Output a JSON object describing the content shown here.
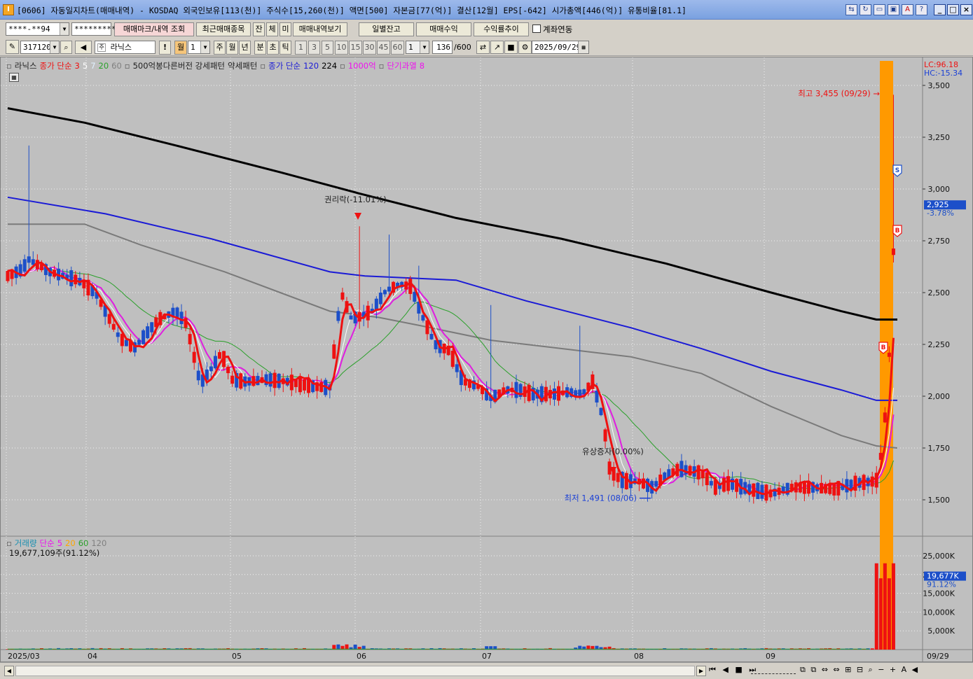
{
  "window": {
    "app_badge": "I",
    "title": "[0606] 자동일지차트(매매내역) - KOSDAQ 외국인보유[113(천)] 주식수[15,260(천)] 액면[500] 자본금[77(억)] 결산[12월] EPS[-642] 시가총액[446(억)] 유통비율[81.1]"
  },
  "toolbar1": {
    "account": "****-**94",
    "password": "*********",
    "trade_mark_btn": "매매마크/내역 조회",
    "recent_btn": "최근매매종목",
    "jan_btn": "잔",
    "che_btn": "체",
    "mi_btn": "미",
    "history_btn": "매매내역보기",
    "daily_balance_btn": "일별잔고",
    "trade_profit_btn": "매매수익",
    "return_btn": "수익률추이",
    "account_link_label": "계좌연동"
  },
  "toolbar2": {
    "code": "317120",
    "name": "라닉스",
    "excl": "!",
    "period_sel": "월",
    "period_num": "1",
    "periods": [
      "주",
      "월",
      "년",
      "분",
      "초",
      "틱"
    ],
    "numbers": [
      "1",
      "3",
      "5",
      "10",
      "15",
      "30",
      "45",
      "60"
    ],
    "unit_val": "1",
    "count": "136",
    "count_max": "/600",
    "date": "2025/09/29"
  },
  "price_legend": {
    "name": "라닉스",
    "ma_label": "종가 단순",
    "ma_periods": [
      "3",
      "5",
      "7",
      "20",
      "60"
    ],
    "pattern1": "500억봉다른버전 강세패턴",
    "pattern2": "약세패턴",
    "ma2_label": "종가 단순",
    "ma2_periods": [
      "120",
      "224"
    ],
    "amount_label": "1000억",
    "overheat_label": "단기과열",
    "overheat_val": "8"
  },
  "volume_legend": {
    "name": "거래량",
    "ma_label": "단순",
    "ma_periods": [
      "5",
      "20",
      "60",
      "120"
    ],
    "current": "19,677,109주(91.12%)"
  },
  "price_axis": {
    "lc": "LC:96.18",
    "hc": "HC:-15.34",
    "ticks": [
      "3,500",
      "3,250",
      "3,000",
      "2,750",
      "2,500",
      "2,250",
      "2,000",
      "1,750",
      "1,500"
    ],
    "current": "2,925",
    "change": "-3.78%"
  },
  "volume_axis": {
    "ticks": [
      "25,000K",
      "20,000K",
      "15,000K",
      "10,000K",
      "5,000K"
    ],
    "current": "19,677K",
    "ratio": "91.12%"
  },
  "date_axis": {
    "labels": [
      "2025/03",
      "04",
      "05",
      "06",
      "07",
      "08",
      "09"
    ],
    "last": "09/29"
  },
  "annotations": {
    "high": "최고 3,455 (09/29)",
    "low": "최저 1,491 (08/06)",
    "rights": "권리락(-11.01%)",
    "capital": "유상증자(0.00%)",
    "buy_mark": "B",
    "sell_mark": "S"
  },
  "colors": {
    "up": "#ee1111",
    "down": "#1c4fc9",
    "ma3": "#ee1111",
    "ma5": "#ffffff",
    "ma7": "#ffffff",
    "ma20": "#e01de0",
    "ma60": "#2aa02a",
    "ma120": "#1a1ad6",
    "ma224": "#7a7a7a",
    "ma_black": "#000000",
    "highlight": "#ff9900",
    "chart_bg": "#bfbfbf"
  },
  "chart_data": {
    "type": "candlestick",
    "price_range": [
      1400,
      3560
    ],
    "volume_range": [
      0,
      27000
    ],
    "x_labels": [
      "2025/03",
      "04",
      "05",
      "06",
      "07",
      "08",
      "09"
    ],
    "candles_approx": [
      {
        "date": "2025/03 start",
        "close": 2580
      },
      {
        "date": "2025/03",
        "high": 3210,
        "close": 2660
      },
      {
        "date": "2025/04",
        "close": 2100
      },
      {
        "date": "2025/05",
        "close": 2040
      },
      {
        "date": "2025/05 end",
        "high": 2830,
        "close": 2690
      },
      {
        "date": "2025/06",
        "close": 2620
      },
      {
        "date": "2025/07",
        "close": 1980
      },
      {
        "date": "2025/07 end",
        "high": 2340,
        "close": 2030
      },
      {
        "date": "2025/08/06",
        "low": 1491,
        "close": 1580
      },
      {
        "date": "2025/09",
        "close": 1550
      },
      {
        "date": "2025/09/29",
        "high": 3455,
        "close": 2925
      }
    ],
    "annotations": [
      {
        "label": "최고 3,455 (09/29)",
        "value": 3455
      },
      {
        "label": "최저 1,491 (08/06)",
        "value": 1491
      }
    ],
    "current_price": 2925,
    "current_change_pct": -3.78,
    "current_volume": 19677109
  }
}
